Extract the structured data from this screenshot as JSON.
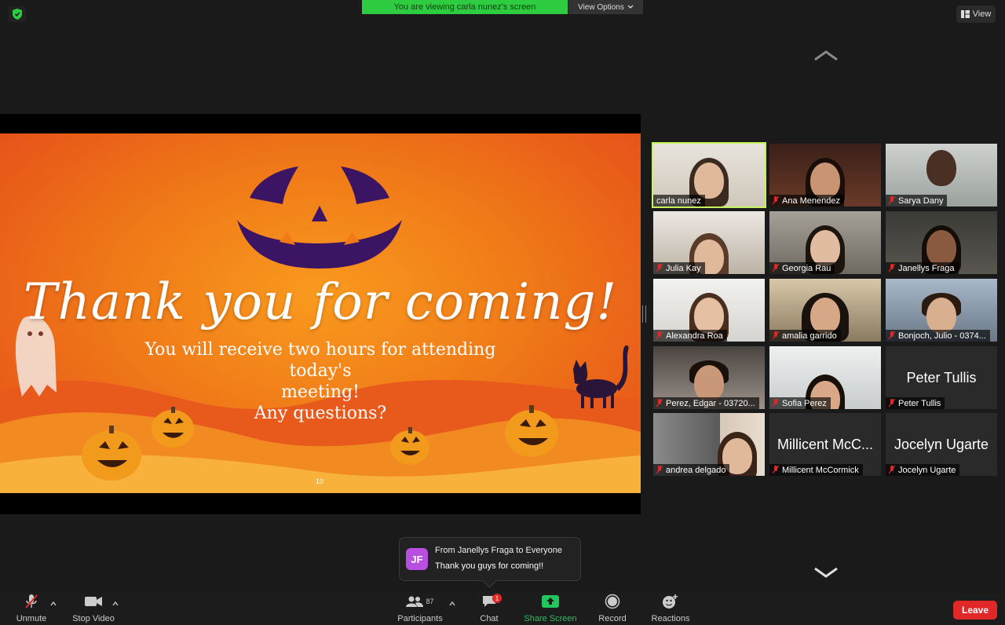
{
  "top_bar": {
    "viewing_banner": "You are viewing carla nunez's screen",
    "view_options_label": "View Options",
    "view_label": "View"
  },
  "slide": {
    "title": "Thank you for coming!",
    "subtitle_line1": "You will receive two hours for attending today's",
    "subtitle_line2": "meeting!",
    "subtitle_line3": "Any questions?",
    "page_number": "10"
  },
  "participants": [
    {
      "name": "carla nunez"
    },
    {
      "name": "Ana Menendez"
    },
    {
      "name": "Sarya Dany"
    },
    {
      "name": "Julia Kay"
    },
    {
      "name": "Georgia Rau"
    },
    {
      "name": "Janellys Fraga"
    },
    {
      "name": "Alexandra Roa"
    },
    {
      "name": "amalia garrido"
    },
    {
      "name": "Bonjoch, Julio - 0374..."
    },
    {
      "name": "Perez, Edgar - 03720..."
    },
    {
      "name": "Sofia Perez"
    },
    {
      "name": "Peter Tullis",
      "display": "Peter Tullis"
    },
    {
      "name": "andrea delgado"
    },
    {
      "name": "Millicent McCormick",
      "display": "Millicent McC..."
    },
    {
      "name": "Jocelyn Ugarte",
      "display": "Jocelyn Ugarte"
    }
  ],
  "chat_popup": {
    "avatar_initials": "JF",
    "from": "From Janellys Fraga to Everyone",
    "message": "Thank you guys for coming!!"
  },
  "toolbar": {
    "unmute": "Unmute",
    "stop_video": "Stop Video",
    "participants": "Participants",
    "participants_count": "87",
    "chat": "Chat",
    "chat_badge": "1",
    "share_screen": "Share Screen",
    "record": "Record",
    "reactions": "Reactions",
    "leave": "Leave"
  },
  "colors": {
    "banner_green": "#2ecc40",
    "active_speaker": "#c6f25b",
    "leave_red": "#e02828",
    "share_green": "#22c55e",
    "chat_avatar": "#b94fe0"
  }
}
